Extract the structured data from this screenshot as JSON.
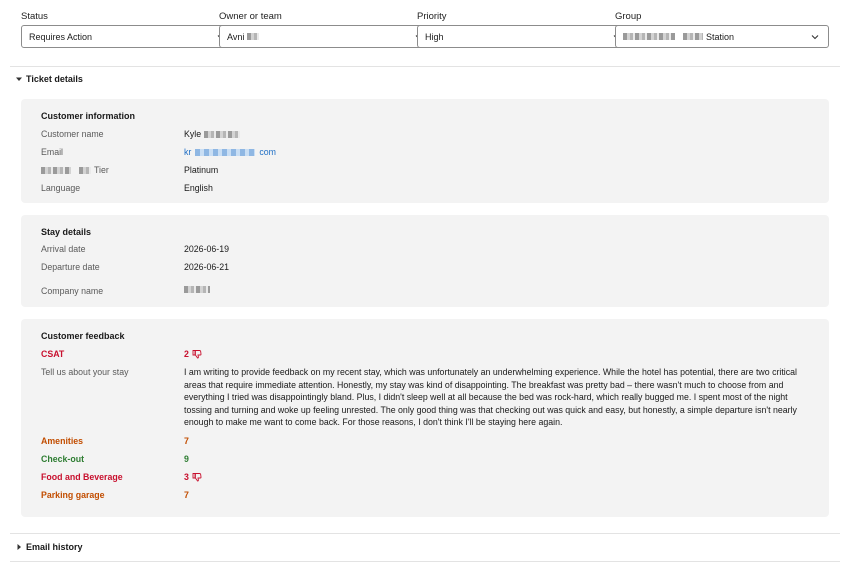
{
  "filters": [
    {
      "label": "Status",
      "value": "Requires Action"
    },
    {
      "label": "Owner or team",
      "value": "Avni"
    },
    {
      "label": "Priority",
      "value": "High"
    },
    {
      "label": "Group",
      "value": "Station"
    }
  ],
  "ticket_details": {
    "toggle_label": "Ticket details",
    "customer_info": {
      "title": "Customer information",
      "rows": [
        {
          "label": "Customer name",
          "value": "Kyle"
        },
        {
          "label": "Email",
          "value_prefix": "kr",
          "value_suffix": "com"
        },
        {
          "label": "Tier",
          "value": "Platinum"
        },
        {
          "label": "Language",
          "value": "English"
        }
      ]
    },
    "stay_details": {
      "title": "Stay details",
      "rows": [
        {
          "label": "Arrival date",
          "value": "2026-06-19"
        },
        {
          "label": "Departure date",
          "value": "2026-06-21"
        },
        {
          "label": "Company name",
          "value": ""
        }
      ]
    },
    "customer_feedback": {
      "title": "Customer feedback",
      "csat": {
        "label": "CSAT",
        "value": "2"
      },
      "tell_us": {
        "label": "Tell us about your stay",
        "text": "I am writing to provide feedback on my recent stay, which was unfortunately an underwhelming experience. While the hotel has potential, there are two critical areas that require immediate attention. Honestly, my stay was kind of disappointing. The breakfast was pretty bad – there wasn't much to choose from and everything I tried was disappointingly bland. Plus, I didn't sleep well at all because the bed was rock-hard, which really bugged me. I spent most of the night tossing and turning and woke up feeling unrested. The only good thing was that checking out was quick and easy, but honestly, a simple departure isn't nearly enough to make me want to come back. For those reasons, I don't think I'll be staying here again."
      },
      "ratings": [
        {
          "label": "Amenities",
          "value": "7",
          "tone": "orange",
          "thumb": false
        },
        {
          "label": "Check-out",
          "value": "9",
          "tone": "green",
          "thumb": false
        },
        {
          "label": "Food and Beverage",
          "value": "3",
          "tone": "red",
          "thumb": true
        },
        {
          "label": "Parking garage",
          "value": "7",
          "tone": "orange",
          "thumb": false
        }
      ]
    }
  },
  "email_history": {
    "toggle_label": "Email history"
  },
  "colors": {
    "accent_link": "#1f6fc5",
    "negative": "#c8102e",
    "neutral": "#c24d00",
    "positive": "#2e7d32",
    "card_bg": "#f3f3f3"
  },
  "icons": {
    "dropdown": "chevron-down-icon",
    "expanded": "caret-down-icon",
    "collapsed": "caret-right-icon",
    "thumb": "thumbs-down-icon"
  }
}
